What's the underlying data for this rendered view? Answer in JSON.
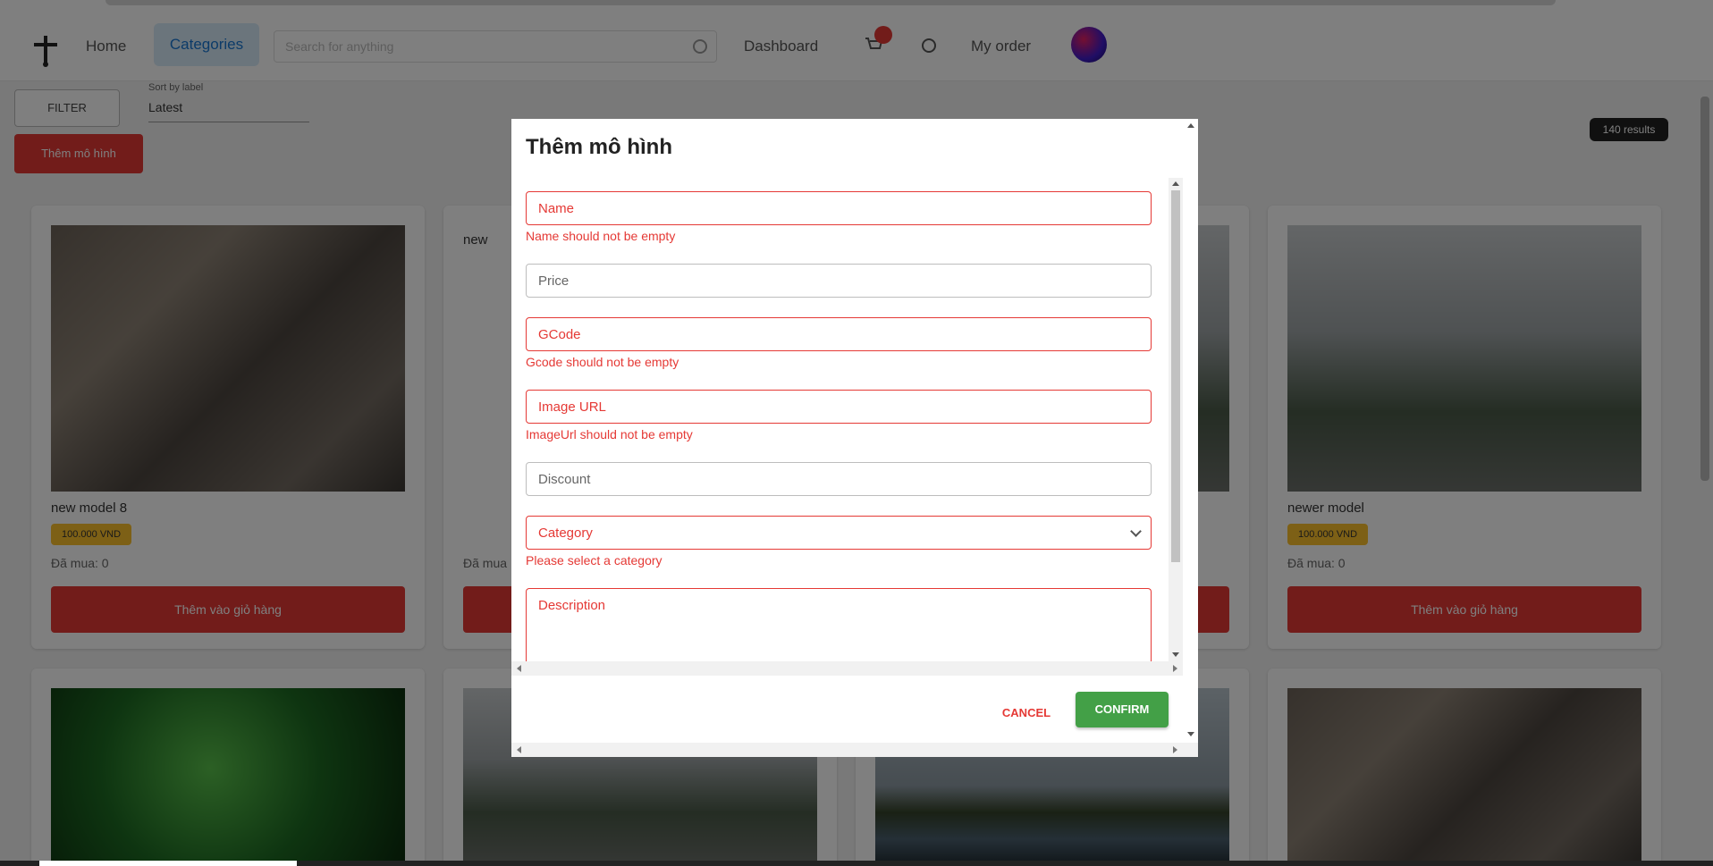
{
  "nav": {
    "home": "Home",
    "categories": "Categories",
    "search_placeholder": "Search for anything",
    "dashboard": "Dashboard",
    "my_order": "My order"
  },
  "toolbar": {
    "filter": "FILTER",
    "sort_label": "Sort by label",
    "sort_value": "Latest",
    "add_button": "Thêm mô hình",
    "count_chip": "140 results"
  },
  "cards": [
    {
      "title": "new model 8",
      "price": "100.000 VND",
      "sold": "Đã mua: 0",
      "cart": "Thêm vào giỏ hàng"
    },
    {
      "title": "new",
      "price": "",
      "sold": "Đã mua",
      "cart": ""
    },
    {
      "title": "",
      "price": "",
      "sold": "",
      "cart": ""
    },
    {
      "title": "newer model",
      "price": "100.000 VND",
      "sold": "Đã mua: 0",
      "cart": "Thêm vào giỏ hàng"
    }
  ],
  "modal": {
    "title": "Thêm mô hình",
    "fields": {
      "name": "Name",
      "name_error": "Name should not be empty",
      "price": "Price",
      "gcode": "GCode",
      "gcode_error": "Gcode should not be empty",
      "image_url": "Image URL",
      "image_url_error": "ImageUrl should not be empty",
      "discount": "Discount",
      "category": "Category",
      "category_error": "Please select a category",
      "description": "Description"
    },
    "cancel": "CANCEL",
    "confirm": "CONFIRM"
  },
  "colors": {
    "error": "#e53935",
    "confirm": "#43a047",
    "overlay": "rgba(0,0,0,0.5)"
  }
}
